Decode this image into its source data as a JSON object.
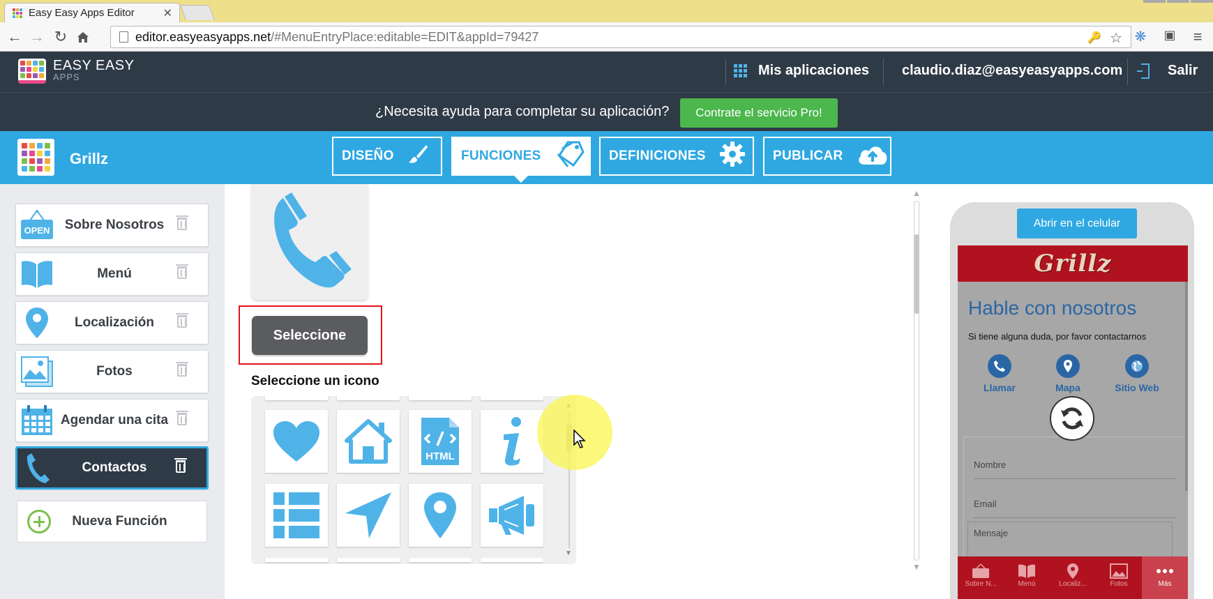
{
  "browser": {
    "tab_title": "Easy Easy Apps Editor",
    "tab_close": "✕",
    "url_host": "editor.easyeasyapps.net",
    "url_path": "/#MenuEntryPlace:editable=EDIT&appId=79427"
  },
  "header": {
    "brand_name": "EASY EASY",
    "brand_sub": "APPS",
    "apps_link": "Mis aplicaciones",
    "user_email": "claudio.diaz@easyeasyapps.com",
    "logout": "Salir"
  },
  "help_bar": {
    "text": "¿Necesita ayuda para completar su aplicación?",
    "pro_button": "Contrate el servicio Pro!"
  },
  "app_bar": {
    "app_name": "Grillz",
    "tabs": [
      {
        "label": "DISEÑO",
        "icon": "brush-icon"
      },
      {
        "label": "FUNCIONES",
        "icon": "tags-icon",
        "active": true
      },
      {
        "label": "DEFINICIONES",
        "icon": "gear-icon"
      },
      {
        "label": "PUBLICAR",
        "icon": "cloud-upload-icon"
      }
    ]
  },
  "sidebar": {
    "items": [
      {
        "label": "Sobre Nosotros",
        "icon": "open-sign-icon",
        "badge": "OPEN"
      },
      {
        "label": "Menú",
        "icon": "book-icon"
      },
      {
        "label": "Localización",
        "icon": "map-pin-icon"
      },
      {
        "label": "Fotos",
        "icon": "photos-icon"
      },
      {
        "label": "Agendar una cita",
        "icon": "calendar-icon"
      },
      {
        "label": "Contactos",
        "icon": "phone-icon",
        "active": true
      }
    ],
    "new_function": "Nueva Función"
  },
  "main": {
    "select_button": "Seleccione",
    "icon_heading": "Seleccione un icono",
    "icons": [
      {
        "name": "heart-icon"
      },
      {
        "name": "home-icon"
      },
      {
        "name": "html-icon",
        "text": "HTML"
      },
      {
        "name": "info-icon"
      },
      {
        "name": "list-icon"
      },
      {
        "name": "navigation-arrow-icon"
      },
      {
        "name": "map-pin-icon"
      },
      {
        "name": "megaphone-icon"
      }
    ]
  },
  "phone": {
    "open_button": "Abrir en el celular",
    "logo": "Grillz",
    "title": "Hable con nosotros",
    "subtitle": "Si tiene alguna duda, por favor contactarnos",
    "actions": [
      {
        "label": "Llamar",
        "icon": "phone-icon"
      },
      {
        "label": "Mapa",
        "icon": "map-pin-icon"
      },
      {
        "label": "Sitio Web",
        "icon": "globe-icon"
      }
    ],
    "form": {
      "name_placeholder": "Nombre",
      "email_placeholder": "Email",
      "message_placeholder": "Mensaje"
    },
    "nav": [
      {
        "label": "Sobre N...",
        "icon": "open-sign-icon"
      },
      {
        "label": "Menú",
        "icon": "book-icon"
      },
      {
        "label": "Localiz...",
        "icon": "map-pin-icon"
      },
      {
        "label": "Fotos",
        "icon": "photos-icon"
      },
      {
        "label": "Más",
        "icon": "more-icon",
        "active": true
      }
    ]
  },
  "colors": {
    "accent_blue": "#2fa8e2",
    "dark_header": "#2f3a47",
    "pro_green": "#4cb74d",
    "grillz_red": "#b0131f",
    "highlight_red": "#e3121b"
  }
}
